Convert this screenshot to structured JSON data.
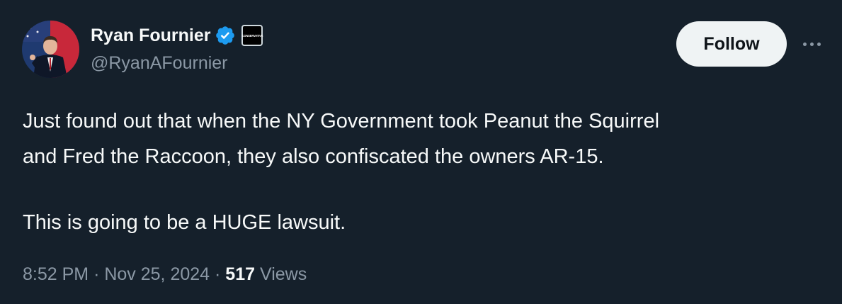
{
  "author": {
    "display_name": "Ryan Fournier",
    "handle": "@RyanAFournier",
    "verified_icon": "verified-badge-icon",
    "affiliation_badge_text": "CONSERVATIVE",
    "avatar": "avatar-photo"
  },
  "actions": {
    "follow_label": "Follow",
    "more_icon": "more-horizontal-icon"
  },
  "tweet": {
    "line1": "Just found out that when the NY Government took Peanut the Squirrel",
    "line2": "and Fred the Raccoon, they also confiscated the owners AR-15.",
    "line3": "This is going to be a HUGE lawsuit."
  },
  "meta": {
    "time": "8:52 PM",
    "separator": "·",
    "date": "Nov 25, 2024",
    "views_count": "517",
    "views_label": "Views"
  },
  "colors": {
    "background": "#15202b",
    "text_primary": "#f7f9f9",
    "text_secondary": "#8b98a5",
    "verified": "#1d9bf0",
    "follow_bg": "#eff3f4"
  }
}
